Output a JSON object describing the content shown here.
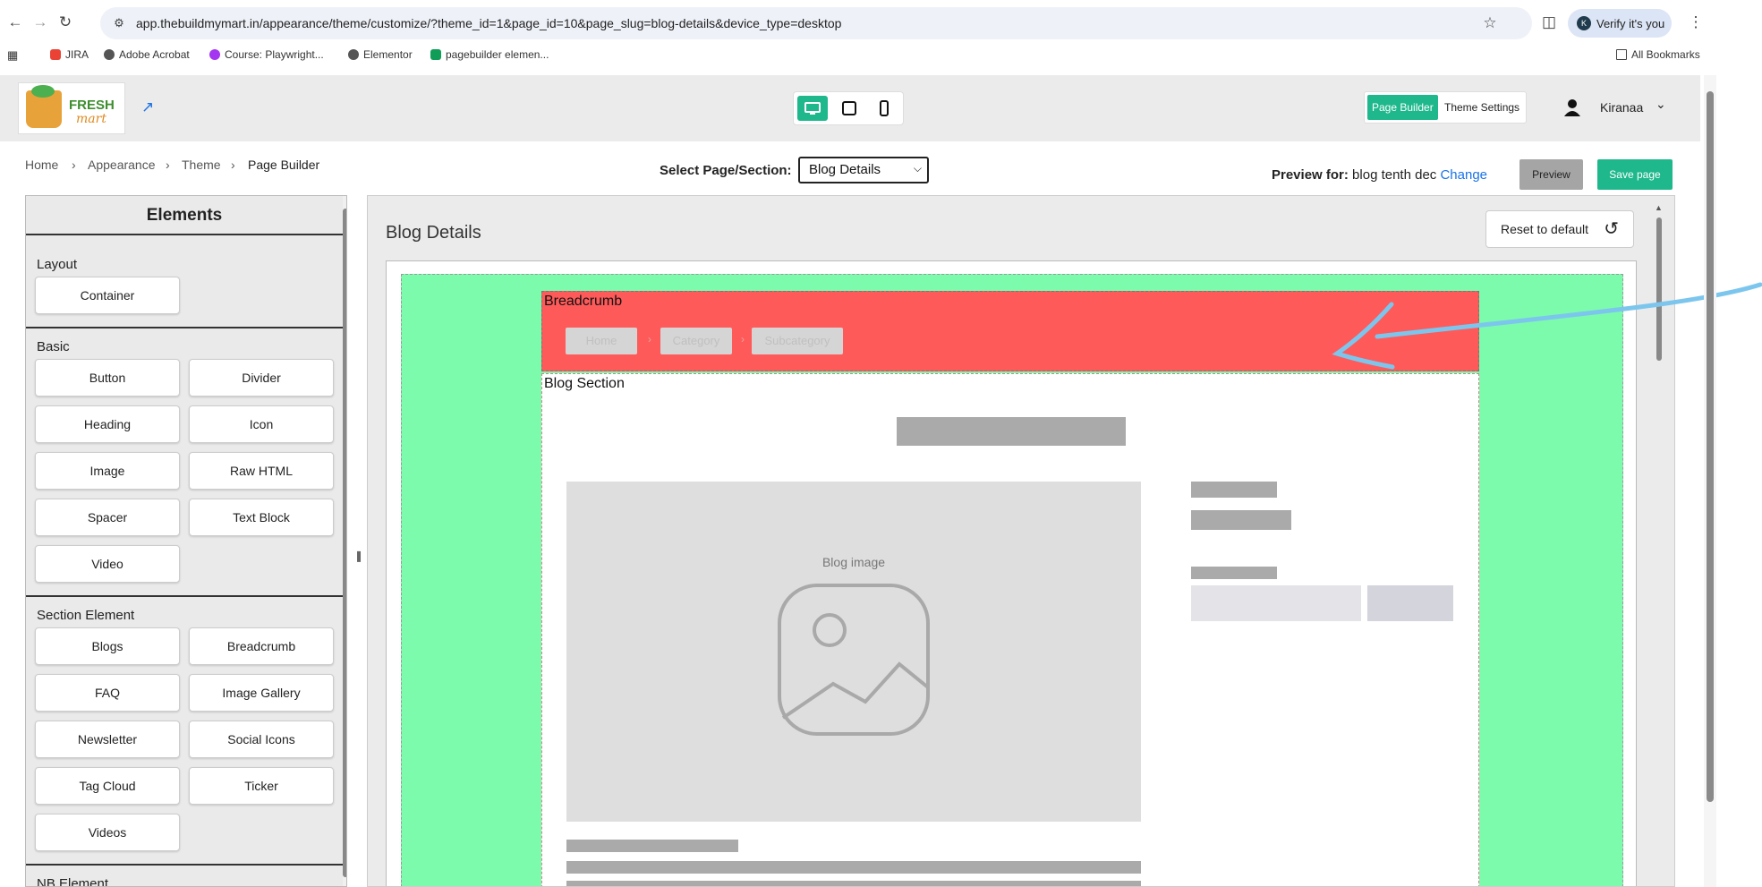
{
  "browser": {
    "url": "app.thebuildmymart.in/appearance/theme/customize/?theme_id=1&page_id=10&page_slug=blog-details&device_type=desktop",
    "verify_label": "Verify it's you",
    "verify_initial": "K",
    "bookmarks": [
      "JIRA",
      "Adobe Acrobat",
      "Course: Playwright...",
      "Elementor",
      "pagebuilder elemen..."
    ],
    "all_bookmarks": "All Bookmarks"
  },
  "header": {
    "logo_text_1": "FRESH",
    "logo_text_2": "mart",
    "mode_tabs": [
      "Page Builder",
      "Theme Settings"
    ],
    "user_name": "Kiranaa"
  },
  "breadcrumb": [
    "Home",
    "Appearance",
    "Theme",
    "Page Builder"
  ],
  "toolbar": {
    "select_label": "Select Page/Section:",
    "select_value": "Blog Details",
    "preview_for_label": "Preview for:",
    "preview_for_value": "blog tenth dec",
    "change_label": "Change",
    "preview_label": "Preview",
    "save_label": "Save page"
  },
  "elements_panel": {
    "title": "Elements",
    "groups": [
      {
        "name": "Layout",
        "items": [
          "Container"
        ]
      },
      {
        "name": "Basic",
        "items": [
          "Button",
          "Divider",
          "Heading",
          "Icon",
          "Image",
          "Raw HTML",
          "Spacer",
          "Text Block",
          "Video"
        ]
      },
      {
        "name": "Section Element",
        "items": [
          "Blogs",
          "Breadcrumb",
          "FAQ",
          "Image Gallery",
          "Newsletter",
          "Social Icons",
          "Tag Cloud",
          "Ticker",
          "Videos"
        ]
      },
      {
        "name": "NB Element",
        "items": []
      }
    ]
  },
  "canvas": {
    "title": "Blog Details",
    "reset_label": "Reset to default",
    "breadcrumb_section_label": "Breadcrumb",
    "breadcrumb_pills": [
      "Home",
      "Category",
      "Subcategory"
    ],
    "blog_section_label": "Blog Section",
    "blog_image_caption": "Blog image"
  },
  "colors": {
    "accent": "#1fb88c",
    "green_area": "#7dfbad",
    "breadcrumb_red": "#ff5a5a",
    "annotation": "#7cc6ee"
  }
}
